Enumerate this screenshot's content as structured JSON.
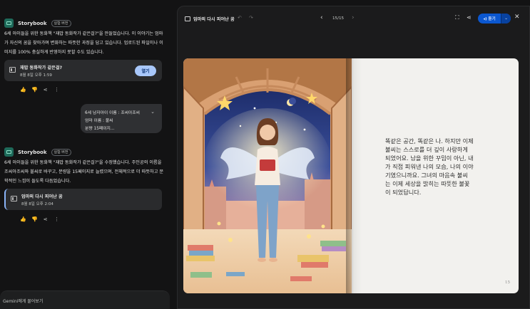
{
  "chat": {
    "messages": [
      {
        "app": "Storybook",
        "badge": "실험 버전",
        "text": "6세 아이들을 위한 동화책 \"재밥 동화작가 같은걸?\"을 만들었습니다. 이 이야기는 엄마가 자신의 꿈을 찾아가며 변화하는 따뜻한 과정을 담고 있습니다. 업로드된 파일이나 이미지를 100% 충실하게 반영하지 못할 수도 있습니다.",
        "card": {
          "title": "재밥 동화작가 같은걸?",
          "date": "8월 8일 오후 1:59",
          "button": "열기"
        }
      },
      {
        "app": "Storybook",
        "badge": "실험 버전",
        "text": "6세 아이들을 위한 동화책 \"재밥 동화작가 같은걸?\"을 수정했습니다. 주인공의 이름을 조씨아조씨와 불씨로 바꾸고, 분량을 15페이지로 늘렸으며, 전체적으로 더 따뜻하고 문학적인 느낌이 들도록 다듬었습니다.",
        "card": {
          "title": "엄마의 다시 피어난 꿈",
          "date": "8월 8일 오후 2:04"
        }
      }
    ],
    "user_bubble": {
      "lines": [
        "6세 남자아이 이름 : 조씨아조씨",
        "엄마 이름 : 불씨",
        "분량 15페이지..."
      ],
      "chevron": "⌄"
    },
    "actions": [
      "👍",
      "👎",
      "⋖",
      "⋮"
    ],
    "input_placeholder": "Gemini에게 물어보기"
  },
  "viewer": {
    "title": "엄마의 다시 피어난 꿈",
    "undo": "↶",
    "redo": "↷",
    "prev": "‹",
    "next": "›",
    "pager": "15/15",
    "listen_label": "◂) 듣기",
    "listen_menu": "⌄",
    "close": "✕",
    "fullscreen": "⛶",
    "share": "⋖"
  },
  "page": {
    "story_text": "똑같은 공간, 똑같은 나. 하지만 이제\n불씨는 스스로를 더 깊이 사랑하게\n되었어요. 남을 위한 꾸밈이 아닌, 내\n가 직접 피워낸 나의 모습, 나의 이야\n기였으니까요. 그녀의 마음속 불씨\n는 이제 세상을 밝히는 따뜻한 불꽃\n이 되었답니다.",
    "page_number": "15"
  }
}
